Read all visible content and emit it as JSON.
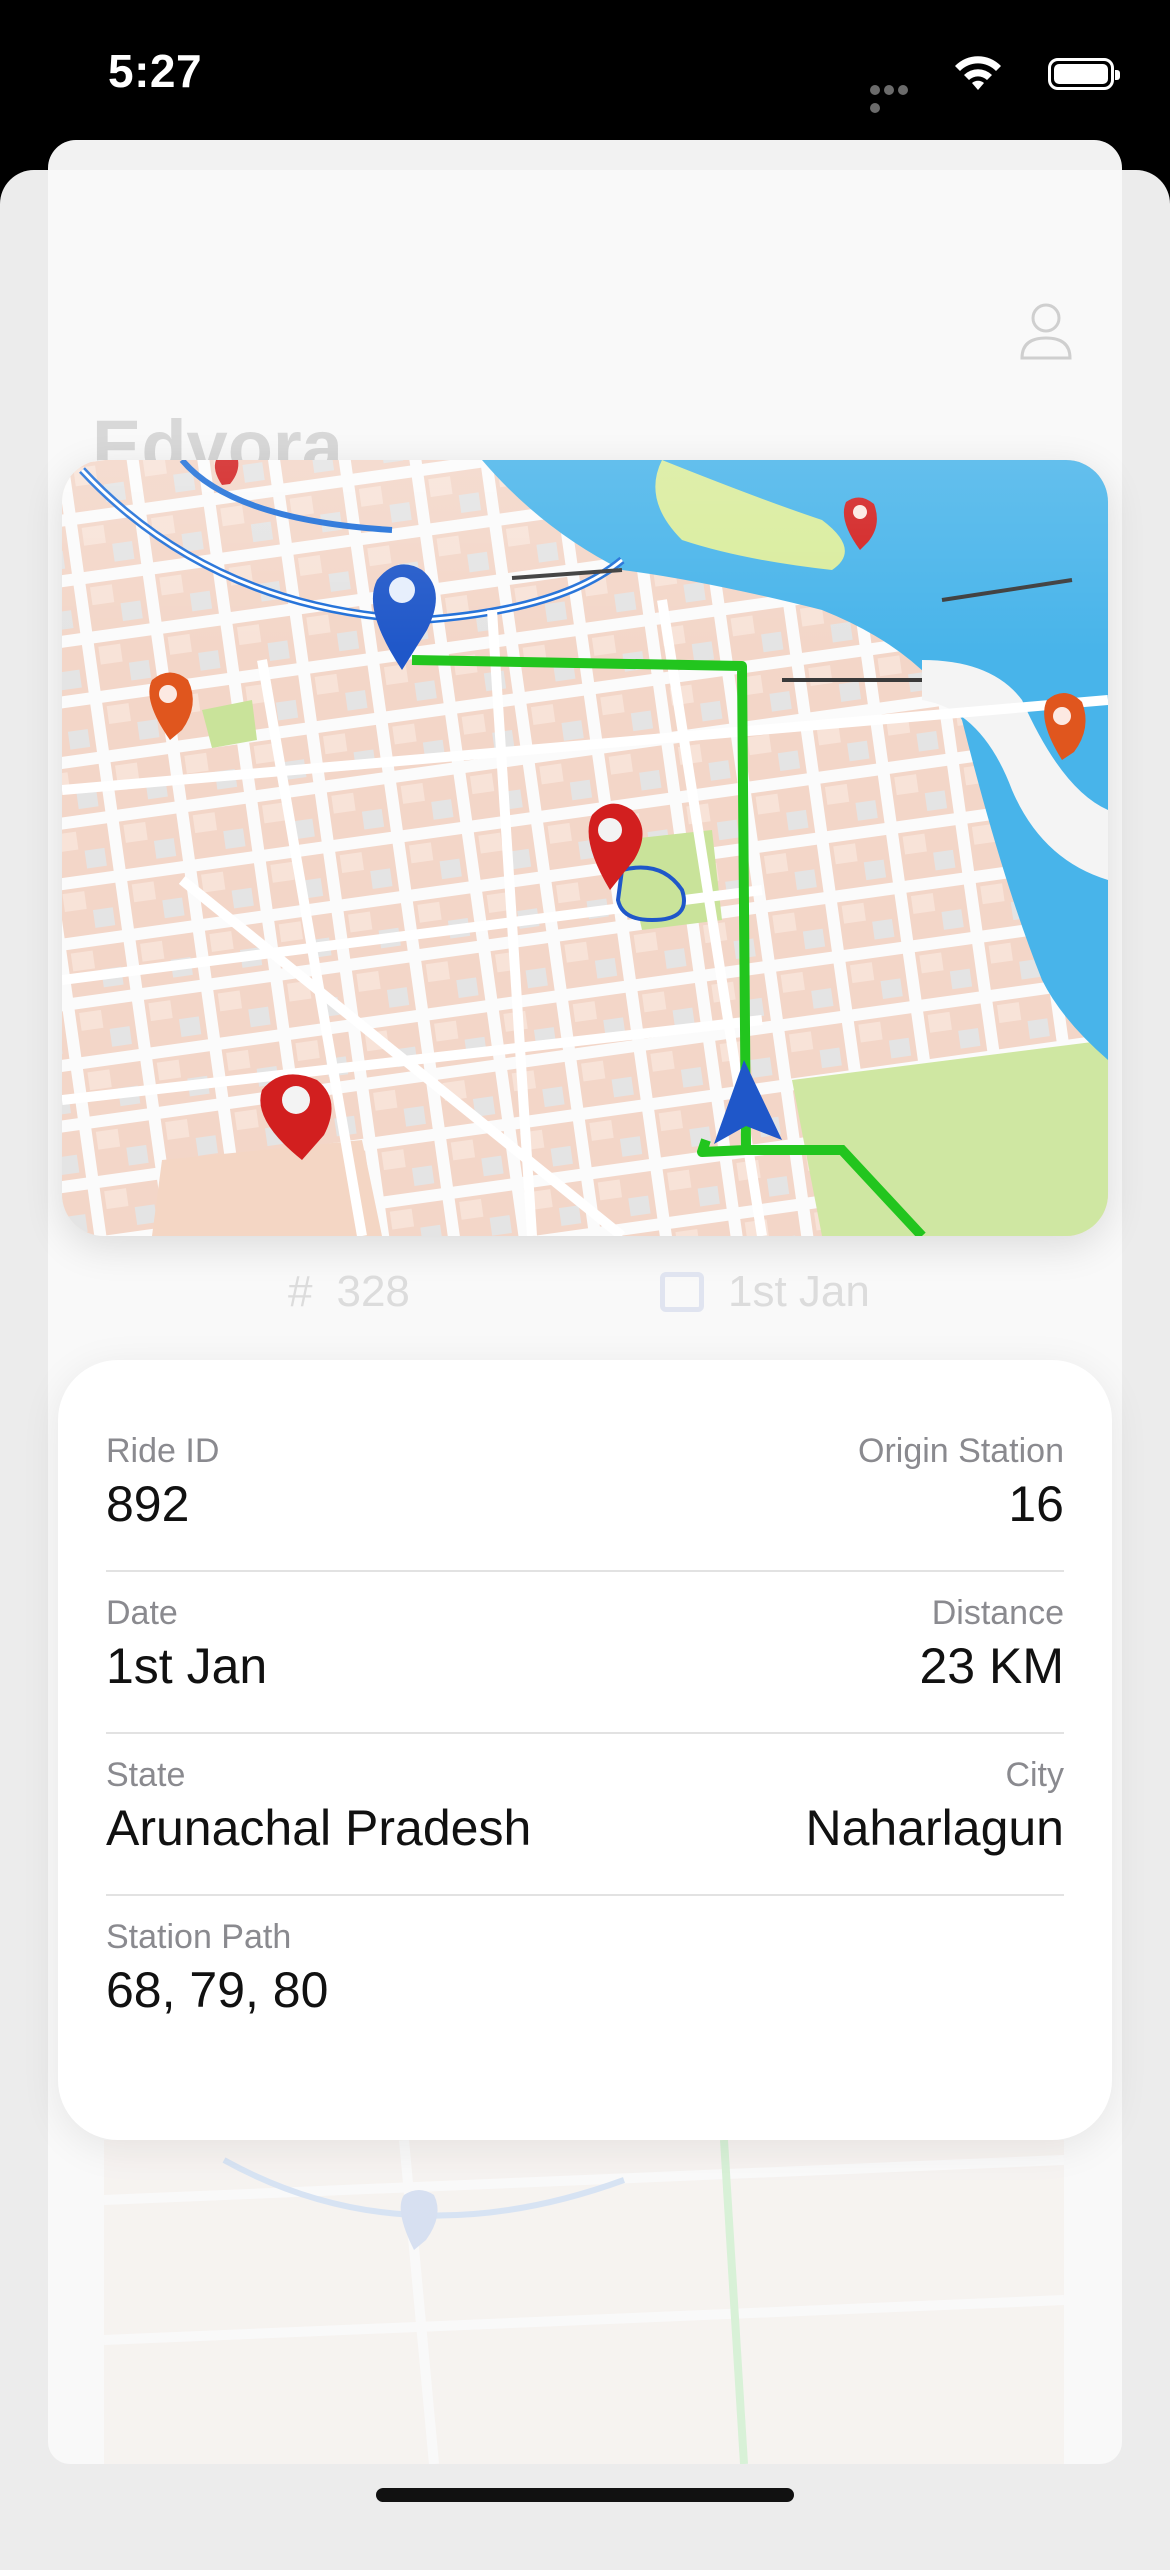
{
  "status_bar": {
    "time": "5:27"
  },
  "header": {
    "app_title": "Edvora"
  },
  "ghost_card": {
    "id_prefix": "#",
    "ride_id": "328",
    "date": "1st Jan"
  },
  "ride_details": {
    "ride_id_label": "Ride ID",
    "ride_id_value": "892",
    "origin_station_label": "Origin Station",
    "origin_station_value": "16",
    "date_label": "Date",
    "date_value": "1st Jan",
    "distance_label": "Distance",
    "distance_value": "23 KM",
    "state_label": "State",
    "state_value": "Arunachal Pradesh",
    "city_label": "City",
    "city_value": "Naharlagun",
    "station_path_label": "Station Path",
    "station_path_value": "68, 79, 80"
  },
  "colors": {
    "route": "#22c51e",
    "river": "#46b5ec",
    "pin_red": "#d21f1f",
    "pin_blue": "#1f57c9",
    "pin_orange": "#e0561e"
  },
  "icons": [
    "signal-dots-icon",
    "wifi-icon",
    "battery-icon",
    "profile-icon",
    "calendar-icon",
    "map-pin-icon",
    "navigation-arrow-icon"
  ]
}
